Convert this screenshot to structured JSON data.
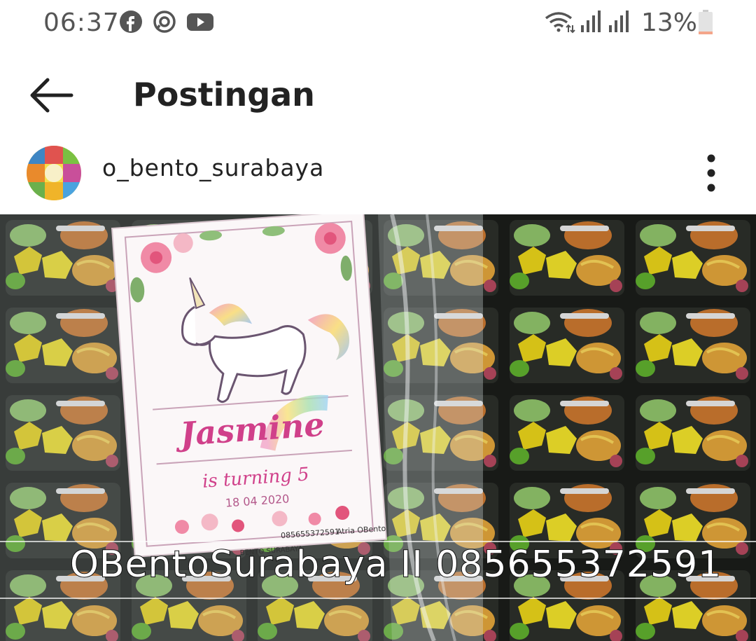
{
  "status_bar": {
    "time": "06:37",
    "notification_icons": [
      "facebook-icon",
      "messenger-ring-icon",
      "youtube-icon"
    ],
    "battery_percent": "13%",
    "battery_level": 0.13,
    "battery_color": "#f4a58a"
  },
  "app_bar": {
    "title": "Postingan",
    "back_icon": "arrow-left-icon"
  },
  "post": {
    "username": "o_bento_surabaya",
    "more_icon": "vertical-dots-icon",
    "image": {
      "card_name": "Jasmine",
      "card_line": "is turning 5",
      "card_date": "18 04 2020",
      "card_phone": "085655372591",
      "card_handle": "Atria OBento",
      "card_location": "BENTO SURABAYA",
      "watermark": "OBentoSurabaya II 085655372591"
    }
  },
  "colors": {
    "text_primary": "#222222",
    "status_text": "#555555",
    "bento_yellow": "#e8d21a",
    "bento_green": "#5fae2e",
    "bento_orange": "#c9772f",
    "card_pink": "#d0408a"
  }
}
